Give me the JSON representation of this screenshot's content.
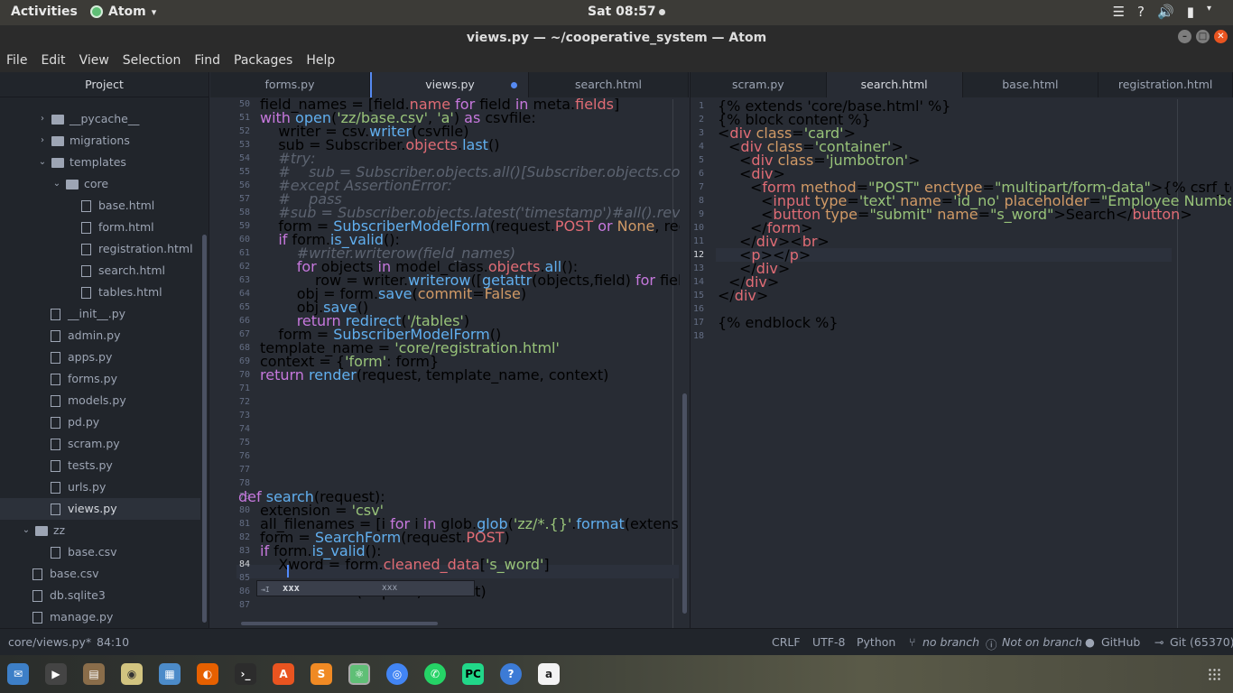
{
  "topbar": {
    "activities": "Activities",
    "app": "Atom",
    "app_arrow": "▾",
    "clock": "Sat 08:57"
  },
  "window": {
    "title": "views.py — ~/cooperative_system — Atom"
  },
  "menu": [
    "File",
    "Edit",
    "View",
    "Selection",
    "Find",
    "Packages",
    "Help"
  ],
  "tree": {
    "header": "Project",
    "items": [
      {
        "label": "__pycache__",
        "type": "folder",
        "collapsed": true
      },
      {
        "label": "migrations",
        "type": "folder",
        "collapsed": true
      },
      {
        "label": "templates",
        "type": "folder",
        "collapsed": false
      },
      {
        "label": "core",
        "type": "folder",
        "collapsed": false
      },
      {
        "label": "base.html",
        "type": "file"
      },
      {
        "label": "form.html",
        "type": "file"
      },
      {
        "label": "registration.html",
        "type": "file"
      },
      {
        "label": "search.html",
        "type": "file"
      },
      {
        "label": "tables.html",
        "type": "file"
      },
      {
        "label": "__init__.py",
        "type": "file"
      },
      {
        "label": "admin.py",
        "type": "file"
      },
      {
        "label": "apps.py",
        "type": "file"
      },
      {
        "label": "forms.py",
        "type": "file"
      },
      {
        "label": "models.py",
        "type": "file"
      },
      {
        "label": "pd.py",
        "type": "file"
      },
      {
        "label": "scram.py",
        "type": "file"
      },
      {
        "label": "tests.py",
        "type": "file"
      },
      {
        "label": "urls.py",
        "type": "file"
      },
      {
        "label": "views.py",
        "type": "file",
        "selected": true
      },
      {
        "label": "zz",
        "type": "folder",
        "collapsed": false
      },
      {
        "label": "base.csv",
        "type": "file"
      },
      {
        "label": "base.csv",
        "type": "file"
      },
      {
        "label": "db.sqlite3",
        "type": "file"
      },
      {
        "label": "manage.py",
        "type": "file"
      }
    ]
  },
  "left_tabs": [
    "forms.py",
    "views.py",
    "search.html"
  ],
  "right_tabs": [
    "scram.py",
    "search.html",
    "base.html",
    "registration.html"
  ],
  "autocomplete": {
    "word": "xxx",
    "right": "xxx"
  },
  "status": {
    "file": "core/views.py*",
    "cursor": "84:10",
    "eol": "CRLF",
    "encoding": "UTF-8",
    "grammar": "Python",
    "branch": "no branch",
    "notbranch": "Not on branch",
    "github": "GitHub",
    "git": "Git (65370)"
  },
  "colors": {
    "accent": "#568af2",
    "editor_bg": "#282c34",
    "panel_bg": "#21252b"
  }
}
